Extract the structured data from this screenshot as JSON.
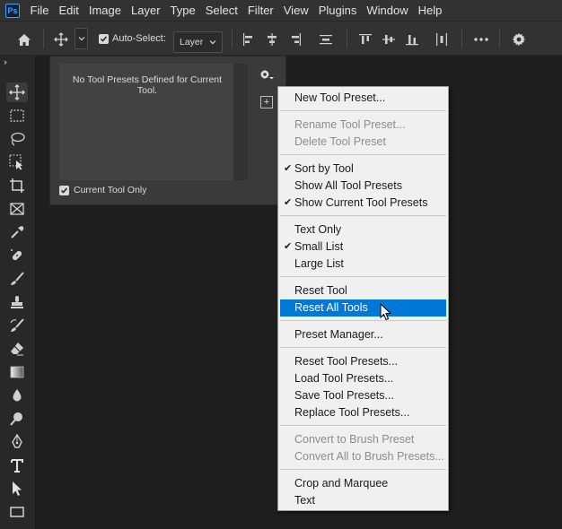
{
  "app": {
    "logo": "Ps"
  },
  "menubar": {
    "items": [
      "File",
      "Edit",
      "Image",
      "Layer",
      "Type",
      "Select",
      "Filter",
      "View",
      "Plugins",
      "Window",
      "Help"
    ]
  },
  "options_bar": {
    "auto_select_label": "Auto-Select:",
    "auto_select_checked": true,
    "auto_select_target": "Layer"
  },
  "tool_presets_panel": {
    "empty_message": "No Tool Presets Defined for Current Tool.",
    "current_tool_only_label": "Current Tool Only",
    "current_tool_only_checked": true
  },
  "menu": {
    "new_tool_preset": "New Tool Preset...",
    "rename_tool_preset": "Rename Tool Preset...",
    "delete_tool_preset": "Delete Tool Preset",
    "sort_by_tool": "Sort by Tool",
    "show_all_tool_presets": "Show All Tool Presets",
    "show_current_tool_presets": "Show Current Tool Presets",
    "text_only": "Text Only",
    "small_list": "Small List",
    "large_list": "Large List",
    "reset_tool": "Reset Tool",
    "reset_all_tools": "Reset All Tools",
    "preset_manager": "Preset Manager...",
    "reset_tool_presets": "Reset Tool Presets...",
    "load_tool_presets": "Load Tool Presets...",
    "save_tool_presets": "Save Tool Presets...",
    "replace_tool_presets": "Replace Tool Presets...",
    "convert_to_brush_preset": "Convert to Brush Preset",
    "convert_all_to_brush_presets": "Convert All to Brush Presets...",
    "crop_and_marquee": "Crop and Marquee",
    "text": "Text",
    "check_mark": "✔"
  },
  "colors": {
    "accent": "#0078d7",
    "panel": "#3a3a3a",
    "canvas": "#1e1e1e"
  }
}
